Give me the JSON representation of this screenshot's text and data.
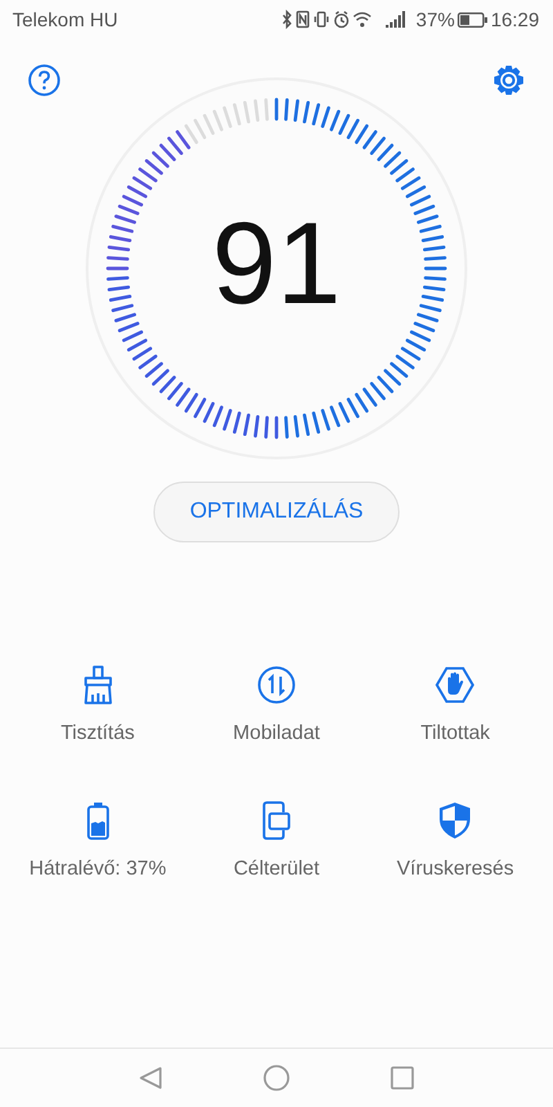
{
  "status_bar": {
    "carrier": "Telekom HU",
    "battery_text": "37%",
    "time": "16:29"
  },
  "gauge": {
    "score": "91"
  },
  "optimize_button": {
    "label": "OPTIMALIZÁLÁS"
  },
  "tiles": [
    {
      "label": "Tisztítás"
    },
    {
      "label": "Mobiladat"
    },
    {
      "label": "Tiltottak"
    },
    {
      "label": "Hátralévő: 37%"
    },
    {
      "label": "Célterület"
    },
    {
      "label": "Víruskeresés"
    }
  ]
}
